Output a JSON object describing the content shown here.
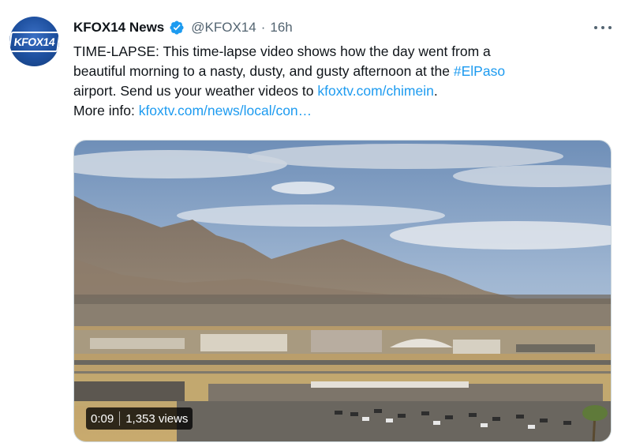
{
  "tweet": {
    "display_name": "KFOX14 News",
    "handle": "@KFOX14",
    "separator": "·",
    "time": "16h",
    "avatar_text": "KFOX14",
    "body_lines": {
      "line1": "TIME-LAPSE: This time-lapse video shows how the day went from a",
      "line2_pre": "beautiful morning to a nasty, dusty, and gusty afternoon at the ",
      "line2_tag": "#ElPaso",
      "line3_pre": "airport. Send us your weather videos to ",
      "line3_link": "kfoxtv.com/chimein",
      "line3_post": ".",
      "line4_pre": "More info: ",
      "line4_link": "kfoxtv.com/news/local/con…"
    },
    "video": {
      "duration": "0:09",
      "views": "1,353 views"
    }
  },
  "colors": {
    "link": "#1d9bf0",
    "verified": "#1d9bf0",
    "secondary_text": "#536471"
  },
  "icons": {
    "verified": "verified-badge-icon",
    "more": "more-options-icon"
  }
}
